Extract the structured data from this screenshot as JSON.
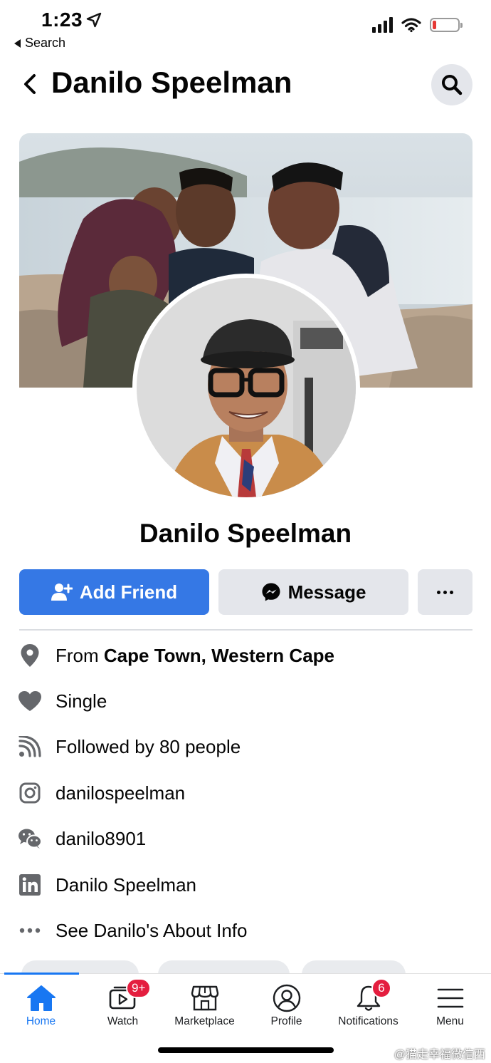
{
  "status_bar": {
    "time": "1:23",
    "back_label": "Search"
  },
  "header": {
    "title": "Danilo Speelman"
  },
  "profile": {
    "name": "Danilo Speelman"
  },
  "actions": {
    "add_friend": "Add Friend",
    "message": "Message"
  },
  "info": {
    "hometown_prefix": "From ",
    "hometown": "Cape Town, Western Cape",
    "relationship": "Single",
    "followers": "Followed by 80 people",
    "instagram": "danilospeelman",
    "wechat": "danilo8901",
    "linkedin": "Danilo Speelman",
    "about_link": "See Danilo's About Info"
  },
  "tabbar": {
    "home": "Home",
    "watch": "Watch",
    "watch_badge": "9+",
    "marketplace": "Marketplace",
    "profile": "Profile",
    "notifications": "Notifications",
    "notifications_badge": "6",
    "menu": "Menu"
  },
  "watermark": "@猫走幸福微信西",
  "colors": {
    "accent": "#1877f2",
    "add_friend_bg": "#3578e5",
    "badge": "#e41e3f",
    "secondary_button": "#e4e6eb"
  },
  "icons": [
    "navigation-arrow-icon",
    "signal-icon",
    "wifi-icon",
    "battery-icon",
    "back-chevron-icon",
    "search-icon",
    "add-person-icon",
    "messenger-icon",
    "more-dots-icon",
    "location-pin-icon",
    "heart-icon",
    "rss-icon",
    "instagram-icon",
    "wechat-icon",
    "linkedin-icon",
    "home-icon",
    "watch-icon",
    "marketplace-icon",
    "profile-icon",
    "bell-icon",
    "menu-icon"
  ]
}
